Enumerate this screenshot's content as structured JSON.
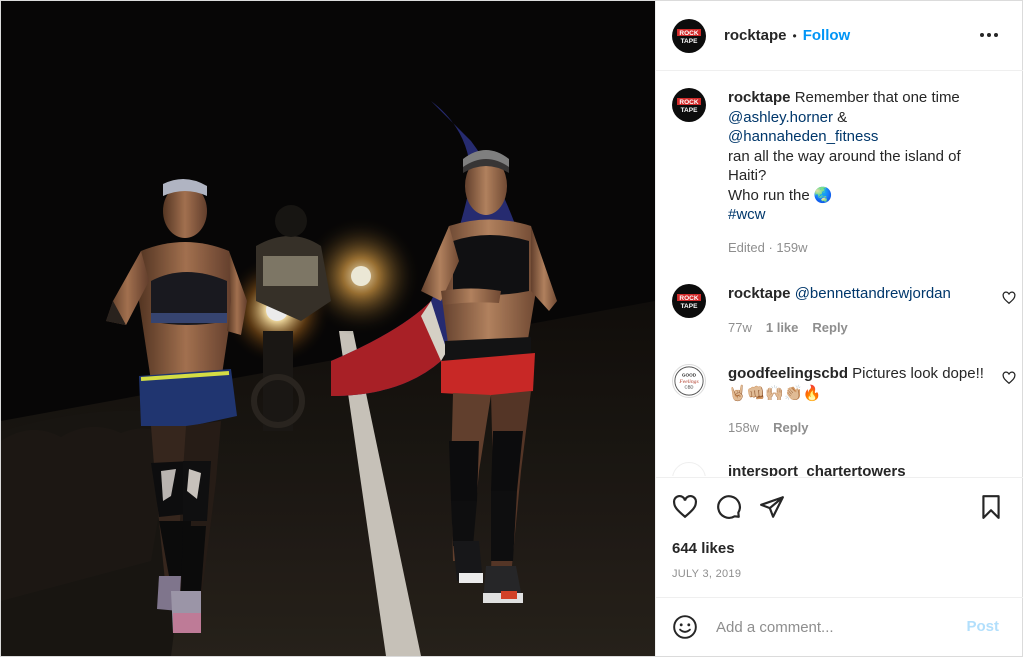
{
  "post": {
    "author": {
      "username": "rocktape",
      "avatar_text_top": "ROCK",
      "avatar_text_bottom": "TAPE",
      "follow_label": "Follow",
      "separator": "•"
    },
    "menu_icon": "more-horizontal-icon",
    "caption": {
      "username": "rocktape",
      "line1": "Remember that one time",
      "mention1": "@ashley.horner",
      "ampersand": "&",
      "mention2": "@hannaheden_fitness",
      "line2": "ran all the way around the island of Haiti?",
      "line3": "Who run the 🌏",
      "hashtag": "#wcw",
      "edited": "Edited · 159w"
    },
    "comments": [
      {
        "username": "rocktape",
        "mention": "@bennettandrewjordan",
        "age": "77w",
        "likes": "1 like",
        "reply": "Reply"
      },
      {
        "username": "goodfeelingscbd",
        "text": "Pictures look dope!!🤘🏼👊🏼🙌🏼👏🏼🔥",
        "age": "158w",
        "reply": "Reply",
        "avatar_text": "GOOD Feelings CBD"
      },
      {
        "username": "intersport_chartertowers",
        "partial": true
      }
    ],
    "likes": "644 likes",
    "date": "JULY 3, 2019",
    "add_comment": {
      "placeholder": "Add a comment...",
      "post_label": "Post"
    },
    "colors": {
      "link": "#00376b",
      "follow": "#0095f6",
      "muted": "#8e8e8e",
      "post_disabled": "#b2dffc",
      "border": "#dbdbdb"
    },
    "icons": [
      "heart-icon",
      "comment-icon",
      "share-icon",
      "bookmark-icon",
      "emoji-icon",
      "heart-outline-icon"
    ]
  }
}
